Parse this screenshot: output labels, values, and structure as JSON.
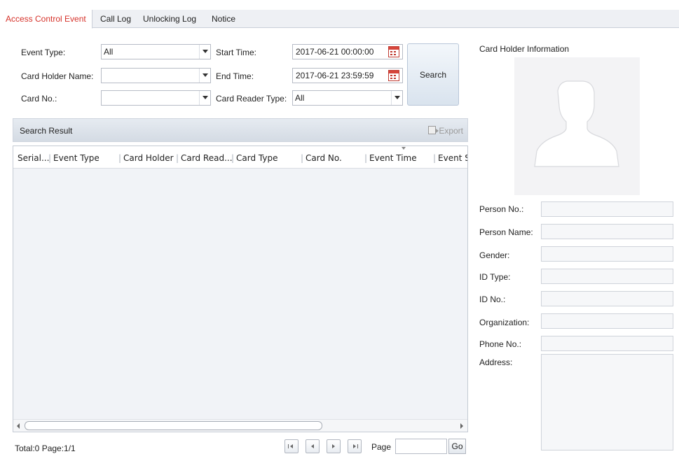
{
  "tabs": [
    {
      "label": "Access Control Event",
      "active": true
    },
    {
      "label": "Call Log",
      "active": false
    },
    {
      "label": "Unlocking Log",
      "active": false
    },
    {
      "label": "Notice",
      "active": false
    }
  ],
  "filters": {
    "event_type": {
      "label": "Event Type:",
      "value": "All"
    },
    "card_holder_name": {
      "label": "Card Holder Name:",
      "value": ""
    },
    "card_no": {
      "label": "Card No.:",
      "value": ""
    },
    "start_time": {
      "label": "Start Time:",
      "value": "2017-06-21 00:00:00"
    },
    "end_time": {
      "label": "End Time:",
      "value": "2017-06-21 23:59:59"
    },
    "card_reader_type": {
      "label": "Card Reader Type:",
      "value": "All"
    },
    "search_label": "Search"
  },
  "results": {
    "title": "Search Result",
    "export_label": "Export",
    "columns": [
      "Serial...",
      "Event Type",
      "Card Holder",
      "Card Read...",
      "Card Type",
      "Card No.",
      "Event Time",
      "Event S"
    ],
    "rows": []
  },
  "pagination": {
    "total_text": "Total:0  Page:1/1",
    "page_label": "Page",
    "page_input": "",
    "go_label": "Go"
  },
  "card_holder_info": {
    "title": "Card Holder Information",
    "fields": [
      {
        "label": "Person No.:",
        "value": ""
      },
      {
        "label": "Person Name:",
        "value": ""
      },
      {
        "label": "Gender:",
        "value": ""
      },
      {
        "label": "ID Type:",
        "value": ""
      },
      {
        "label": "ID No.:",
        "value": ""
      },
      {
        "label": "Organization:",
        "value": ""
      },
      {
        "label": "Phone No.:",
        "value": ""
      },
      {
        "label": "Address:",
        "value": ""
      }
    ]
  },
  "colors": {
    "active_tab_text": "#d6322a",
    "calendar_icon": "#d6453b"
  }
}
